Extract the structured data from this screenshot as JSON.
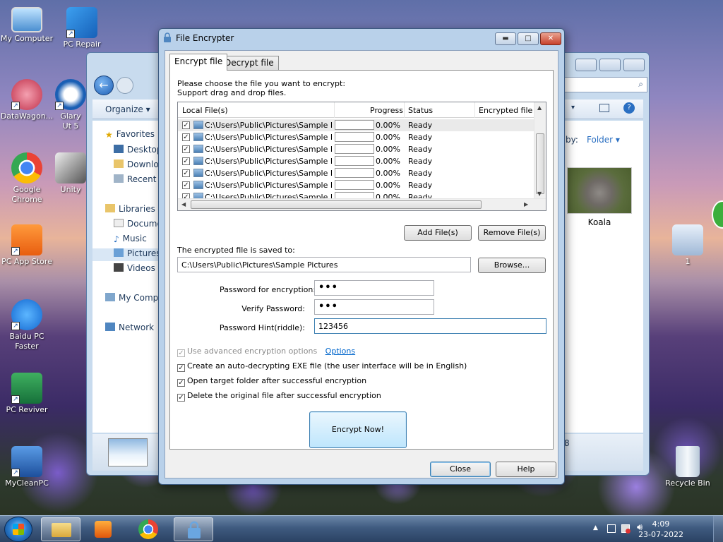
{
  "desktop": {
    "icons": [
      {
        "label": "My Computer"
      },
      {
        "label": "PC Repair"
      },
      {
        "label": "DataWagon..."
      },
      {
        "label": "Glary Ut 5"
      },
      {
        "label": "Google Chrome"
      },
      {
        "label": "Unity"
      },
      {
        "label": "PC App Store"
      },
      {
        "label": "Baidu PC Faster"
      },
      {
        "label": "PC Reviver"
      },
      {
        "label": "MyCleanPC"
      },
      {
        "label": "1"
      },
      {
        "label": "Recycle Bin"
      }
    ]
  },
  "explorer": {
    "organize": "Organize",
    "view_by_label": "by:",
    "view_by_value": "Folder",
    "sidebar": {
      "favorites": "Favorites",
      "desktop": "Desktop",
      "downloads": "Downlo",
      "recent": "Recent P",
      "libraries": "Libraries",
      "documents": "Docume",
      "music": "Music",
      "pictures": "Pictures",
      "videos": "Videos",
      "computer": "My Comp",
      "network": "Network"
    },
    "thumbnail_label": "Koala",
    "status_count": "8"
  },
  "dialog": {
    "title": "File Encrypter",
    "tabs": [
      {
        "label": "Encrypt file",
        "active": true
      },
      {
        "label": "Decrypt file",
        "active": false
      }
    ],
    "instructions": [
      "Please choose the file you want to encrypt:",
      "Support drag and drop files."
    ],
    "table": {
      "headers": [
        "Local File(s)",
        "Progress",
        "Status",
        "Encrypted file"
      ],
      "rows": [
        {
          "checked": true,
          "path": "C:\\Users\\Public\\Pictures\\Sample Pi...",
          "progress": "0.00%",
          "status": "Ready",
          "encrypted": ""
        },
        {
          "checked": true,
          "path": "C:\\Users\\Public\\Pictures\\Sample Pi...",
          "progress": "0.00%",
          "status": "Ready",
          "encrypted": ""
        },
        {
          "checked": true,
          "path": "C:\\Users\\Public\\Pictures\\Sample Pi...",
          "progress": "0.00%",
          "status": "Ready",
          "encrypted": ""
        },
        {
          "checked": true,
          "path": "C:\\Users\\Public\\Pictures\\Sample Pi...",
          "progress": "0.00%",
          "status": "Ready",
          "encrypted": ""
        },
        {
          "checked": true,
          "path": "C:\\Users\\Public\\Pictures\\Sample Pi...",
          "progress": "0.00%",
          "status": "Ready",
          "encrypted": ""
        },
        {
          "checked": true,
          "path": "C:\\Users\\Public\\Pictures\\Sample Pi...",
          "progress": "0.00%",
          "status": "Ready",
          "encrypted": ""
        },
        {
          "checked": true,
          "path": "C:\\Users\\Public\\Pictures\\Sample Pi...",
          "progress": "0.00%",
          "status": "Ready",
          "encrypted": ""
        }
      ]
    },
    "add_files_label": "Add File(s)",
    "remove_files_label": "Remove File(s)",
    "save_location_label": "The encrypted file is saved to:",
    "save_location_value": "C:\\Users\\Public\\Pictures\\Sample Pictures",
    "browse_label": "Browse...",
    "password_label": "Password for encryption:",
    "password_value": "•••",
    "verify_label": "Verify Password:",
    "verify_value": "•••",
    "hint_label": "Password Hint(riddle):",
    "hint_value": "123456",
    "options": {
      "advanced_label": "Use advanced encryption options",
      "advanced_checked": true,
      "advanced_enabled": false,
      "options_link": "Options",
      "exe_label": "Create an auto-decrypting EXE file (the user interface will be in English)",
      "exe_checked": true,
      "open_folder_label": "Open target folder after successful encryption",
      "open_folder_checked": true,
      "delete_label": "Delete the original file after successful encryption",
      "delete_checked": true
    },
    "encrypt_label": "Encrypt Now!",
    "close_label": "Close",
    "help_label": "Help"
  },
  "taskbar": {
    "time": "4:09",
    "date": "23-07-2022"
  }
}
